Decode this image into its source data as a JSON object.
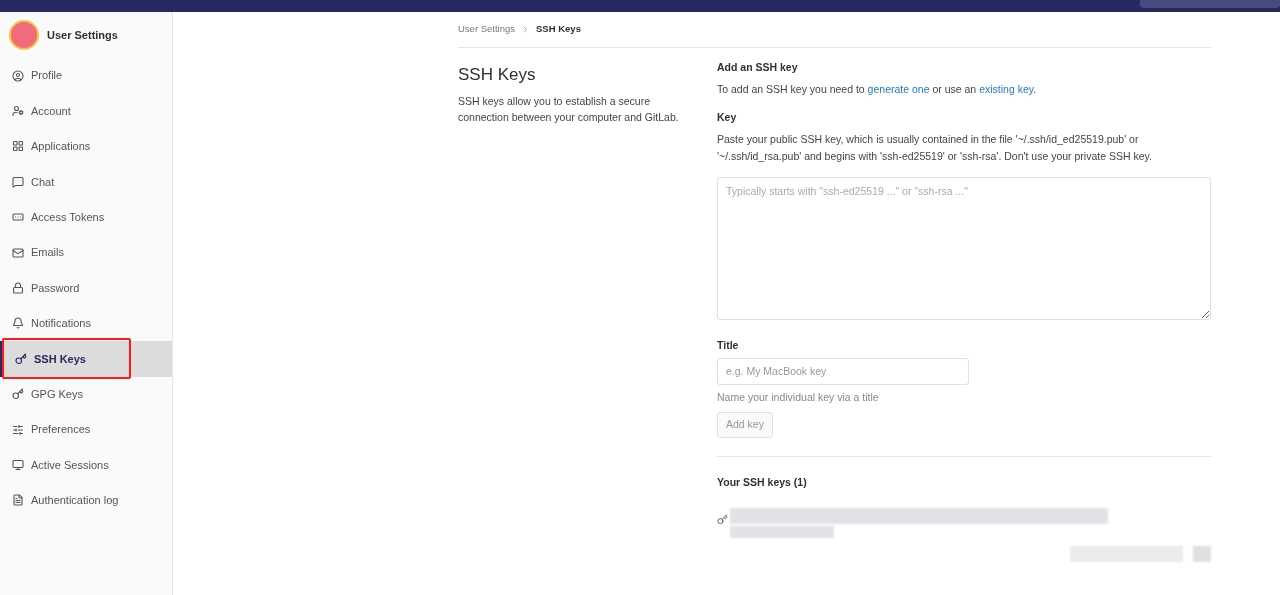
{
  "sidebar": {
    "title": "User Settings",
    "items": [
      {
        "label": "Profile",
        "selected": false,
        "highlighted": false
      },
      {
        "label": "Account",
        "selected": false,
        "highlighted": false
      },
      {
        "label": "Applications",
        "selected": false,
        "highlighted": false
      },
      {
        "label": "Chat",
        "selected": false,
        "highlighted": false
      },
      {
        "label": "Access Tokens",
        "selected": false,
        "highlighted": false
      },
      {
        "label": "Emails",
        "selected": false,
        "highlighted": false
      },
      {
        "label": "Password",
        "selected": false,
        "highlighted": false
      },
      {
        "label": "Notifications",
        "selected": false,
        "highlighted": false
      },
      {
        "label": "SSH Keys",
        "selected": true,
        "highlighted": true
      },
      {
        "label": "GPG Keys",
        "selected": false,
        "highlighted": false
      },
      {
        "label": "Preferences",
        "selected": false,
        "highlighted": false
      },
      {
        "label": "Active Sessions",
        "selected": false,
        "highlighted": false
      },
      {
        "label": "Authentication log",
        "selected": false,
        "highlighted": false
      }
    ]
  },
  "breadcrumb": [
    {
      "label": "User Settings",
      "current": false
    },
    {
      "label": "SSH Keys",
      "current": true
    }
  ],
  "intro": {
    "title": "SSH Keys",
    "text": "SSH keys allow you to establish a secure connection between your computer and GitLab."
  },
  "form": {
    "heading": "Add an SSH key",
    "sentence": [
      {
        "kind": "text",
        "text": "To add an SSH key you need to "
      },
      {
        "kind": "link",
        "text": "generate one"
      },
      {
        "kind": "text",
        "text": " or use an "
      },
      {
        "kind": "link",
        "text": "existing key"
      },
      {
        "kind": "text",
        "text": "."
      }
    ],
    "key_label": "Key",
    "key_help": "Paste your public SSH key, which is usually contained in the file '~/.ssh/id_ed25519.pub' or '~/.ssh/id_rsa.pub' and begins with 'ssh-ed25519' or 'ssh-rsa'. Don't use your private SSH key.",
    "key_placeholder": "Typically starts with \"ssh-ed25519 ...\" or \"ssh-rsa ...\"",
    "title_label": "Title",
    "title_placeholder": "e.g. My MacBook key",
    "title_help": "Name your individual key via a title",
    "submit": {
      "label": "Add key",
      "disabled": true
    }
  },
  "keys": {
    "heading": "Your SSH keys (1)"
  }
}
